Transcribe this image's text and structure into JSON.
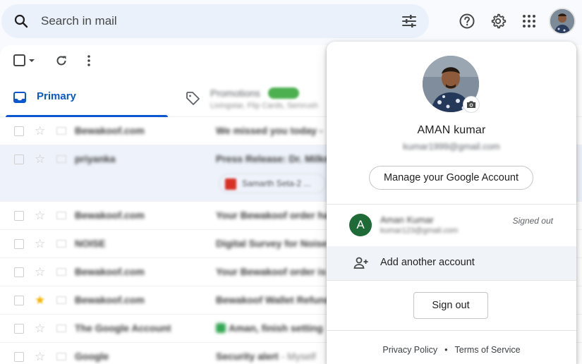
{
  "search": {
    "placeholder": "Search in mail"
  },
  "icons": {
    "search": "search-icon",
    "tune": "tune-icon",
    "help": "help-icon",
    "settings": "gear-icon",
    "apps": "apps-grid-icon",
    "select": "checkbox-icon",
    "refresh": "refresh-icon",
    "more": "more-vert-icon",
    "inbox": "inbox-icon",
    "tag": "tag-icon",
    "camera": "camera-icon",
    "add_person": "person-add-icon"
  },
  "tabs": {
    "primary": "Primary",
    "promotions": "Promotions",
    "promotions_badge": "",
    "promotions_sub": "Livingstar, Flip Cards, Semrush"
  },
  "rows": [
    {
      "sender": "Bewakoof.com",
      "subject": "We missed you today -",
      "tall": false,
      "starred": false
    },
    {
      "sender": "priyanka",
      "subject": "Press Release: Dr. Milkman",
      "tall": true,
      "attachment": "Samarth Seta-2 ...",
      "starred": false
    },
    {
      "sender": "Bewakoof.com",
      "subject": "Your Bewakoof order ha",
      "tall": false,
      "starred": false
    },
    {
      "sender": "NOISE",
      "subject": "Digital Survey for Noise",
      "tall": false,
      "starred": false
    },
    {
      "sender": "Bewakoof.com",
      "subject": "Your Bewakoof order is",
      "tall": false,
      "starred": false
    },
    {
      "sender": "Bewakoof.com",
      "subject": "Bewakoof Wallet Refund",
      "tall": false,
      "starred": true
    },
    {
      "sender": "The Google Account",
      "subject": "Aman, finish setting",
      "tall": false,
      "starred": false,
      "green": true
    },
    {
      "sender": "Google",
      "subject": "Security alert",
      "subject_extra": " - Myself",
      "tall": false,
      "starred": false
    }
  ],
  "account_menu": {
    "name": "AMAN kumar",
    "email": "kumar1999@gmail.com",
    "manage_label": "Manage your Google Account",
    "other_account": {
      "initial": "A",
      "name": "Aman Kumar",
      "email": "kumar123@gmail.com",
      "status": "Signed out"
    },
    "add_account_label": "Add another account",
    "sign_out_label": "Sign out",
    "privacy_label": "Privacy Policy",
    "separator": "•",
    "terms_label": "Terms of Service"
  },
  "colors": {
    "accent_blue": "#0b57d0",
    "search_bg": "#eaf1fb",
    "avatar_green": "#1e6b37"
  }
}
